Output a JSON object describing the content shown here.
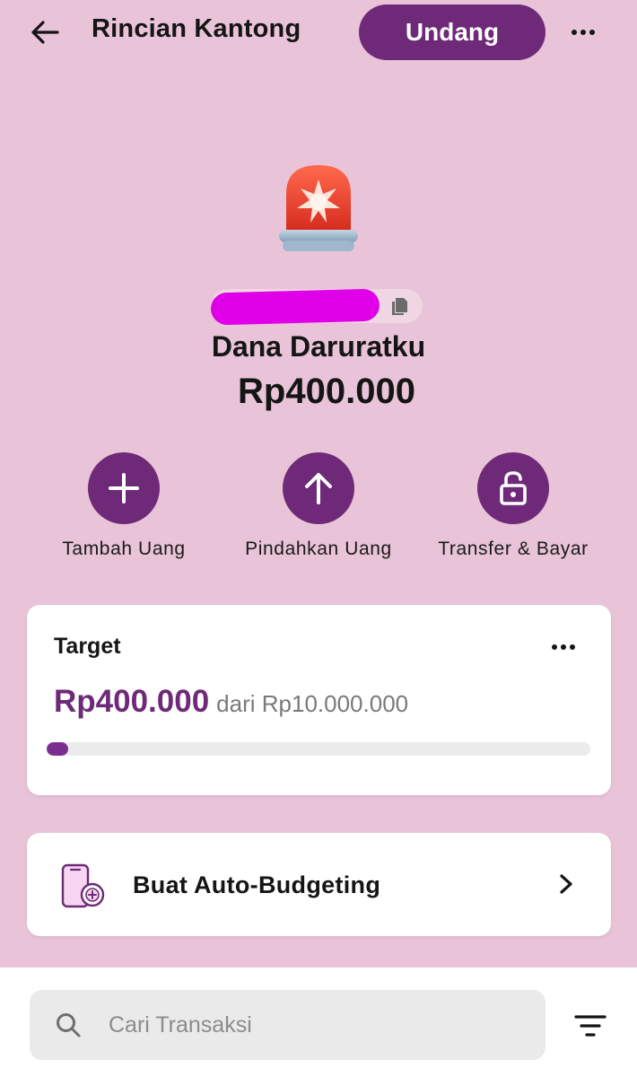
{
  "header": {
    "title": "Rincian Kantong",
    "invite_label": "Undang"
  },
  "pocket": {
    "icon": "siren-icon",
    "name": "Dana Daruratku",
    "balance": "Rp400.000"
  },
  "actions": [
    {
      "label": "Tambah Uang",
      "icon": "plus-icon"
    },
    {
      "label": "Pindahkan Uang",
      "icon": "arrow-up-icon"
    },
    {
      "label": "Transfer & Bayar",
      "icon": "unlock-icon"
    }
  ],
  "target": {
    "title": "Target",
    "amount": "Rp400.000",
    "of_text": "dari Rp10.000.000",
    "progress_fraction": 0.04,
    "accent_color": "#6e2a78"
  },
  "auto_budgeting": {
    "label": "Buat Auto-Budgeting"
  },
  "search": {
    "placeholder": "Cari Transaksi",
    "value": ""
  },
  "colors": {
    "background": "#e9c3d7",
    "accent": "#6e2a78",
    "redaction": "#e000e8"
  }
}
